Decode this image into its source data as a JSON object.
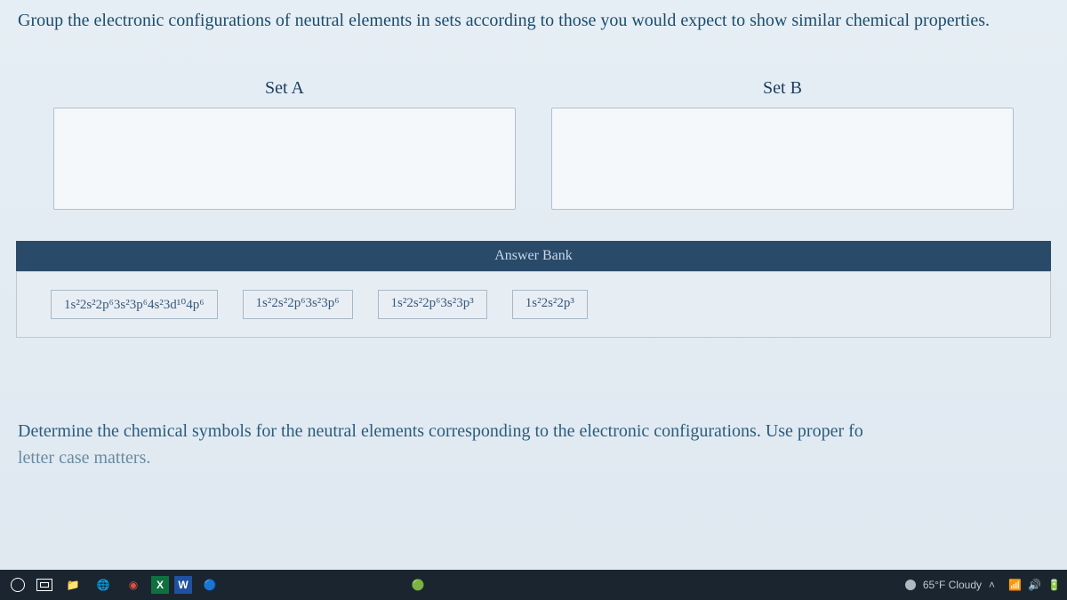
{
  "question": "Group the electronic configurations of neutral elements in sets according to those you would expect to show similar chemical properties.",
  "sets": {
    "a_label": "Set A",
    "b_label": "Set B"
  },
  "answer_bank_label": "Answer Bank",
  "configs": [
    "1s²2s²2p⁶3s²3p⁶4s²3d¹⁰4p⁶",
    "1s²2s²2p⁶3s²3p⁶",
    "1s²2s²2p⁶3s²3p³",
    "1s²2s²2p³"
  ],
  "second_question": {
    "line1": "Determine the chemical symbols for the neutral elements corresponding to the electronic configurations. Use proper fo",
    "line2": "letter case matters."
  },
  "taskbar": {
    "weather": "65°F Cloudy"
  }
}
